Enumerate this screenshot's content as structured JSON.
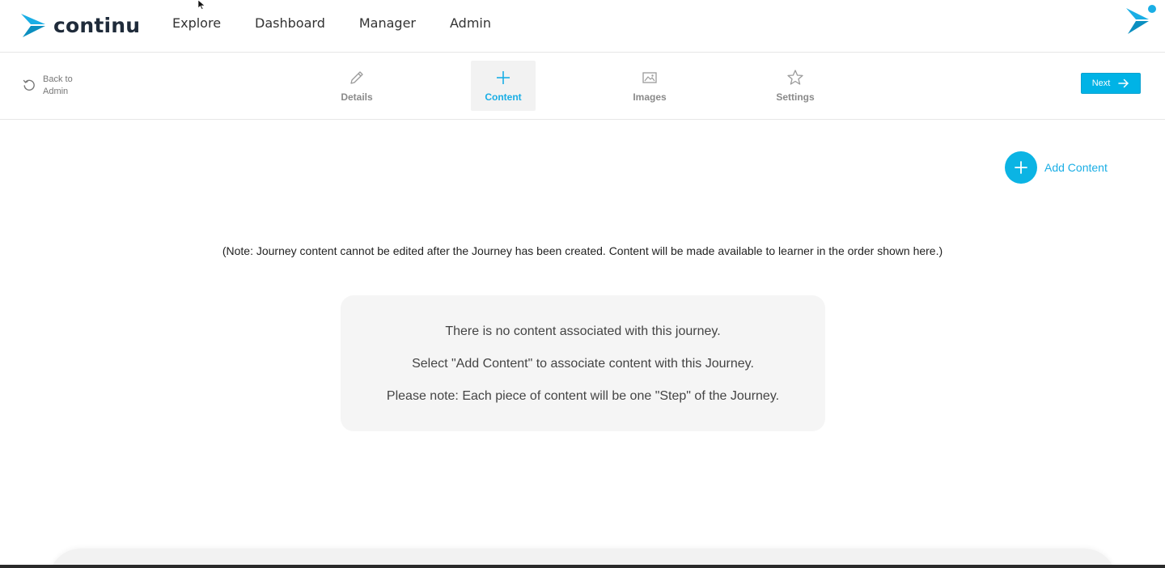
{
  "app": {
    "brand": "continu",
    "brand_color": "#1aaee5"
  },
  "nav": {
    "items": [
      {
        "label": "Explore"
      },
      {
        "label": "Dashboard"
      },
      {
        "label": "Manager"
      },
      {
        "label": "Admin"
      }
    ]
  },
  "toolbar": {
    "back_label_line1": "Back to",
    "back_label_line2": "Admin",
    "steps": [
      {
        "label": "Details",
        "icon": "pencil-icon",
        "active": false
      },
      {
        "label": "Content",
        "icon": "plus-icon",
        "active": true
      },
      {
        "label": "Images",
        "icon": "image-icon",
        "active": false
      },
      {
        "label": "Settings",
        "icon": "star-icon",
        "active": false
      }
    ],
    "next_label": "Next"
  },
  "main": {
    "add_content_label": "Add Content",
    "note": "(Note: Journey content cannot be edited after the Journey has been created. Content will be made available to learner in the order shown here.)",
    "empty_state": {
      "line1": "There is no content associated with this journey.",
      "line2": "Select \"Add Content\" to associate content with this Journey.",
      "line3": "Please note: Each piece of content will be one \"Step\" of the Journey."
    }
  }
}
